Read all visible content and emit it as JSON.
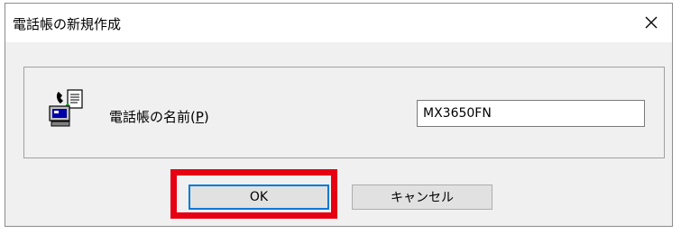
{
  "window": {
    "title": "電話帳の新規作成",
    "close_glyph": "✕"
  },
  "form": {
    "label_prefix": "電話帳の名前(",
    "label_mnemonic": "P",
    "label_suffix": ")",
    "name_value": "MX3650FN"
  },
  "buttons": {
    "ok_label": "OK",
    "cancel_label": "キャンセル"
  },
  "icons": {
    "form_icon": "phonebook-computer-icon",
    "close_icon": "close-icon"
  },
  "colors": {
    "highlight": "#e60012",
    "focus_border": "#0078d7"
  }
}
